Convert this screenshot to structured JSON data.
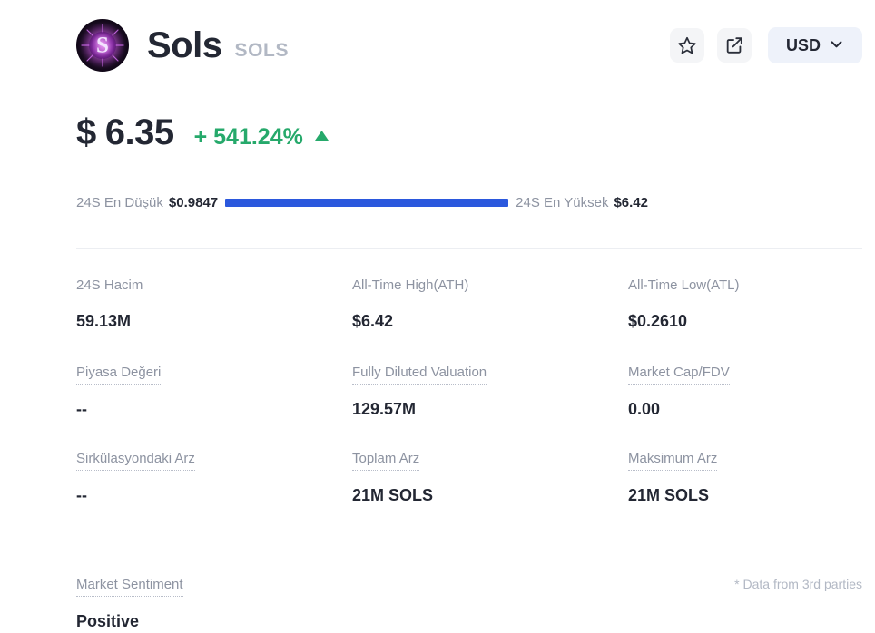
{
  "header": {
    "coin_name": "Sols",
    "coin_ticker": "SOLS",
    "logo_symbol": "S",
    "favorite_icon": "star-icon",
    "share_icon": "external-link-icon",
    "currency_label": "USD",
    "chevron_icon": "chevron-down-icon"
  },
  "price": {
    "currency_sign": "$",
    "value": "6.35",
    "change": "+ 541.24%",
    "change_direction": "up",
    "change_color": "#26a96b"
  },
  "range": {
    "low_label": "24S En Düşük",
    "low_value": "$0.9847",
    "high_label": "24S En Yüksek",
    "high_value": "$6.42",
    "fill_percent": 100,
    "fill_color": "#2b58dd"
  },
  "stats": {
    "row1": [
      {
        "label": "24S Hacim",
        "value": "59.13M",
        "dotted": false
      },
      {
        "label": "All-Time High(ATH)",
        "value": "$6.42",
        "dotted": false
      },
      {
        "label": "All-Time Low(ATL)",
        "value": "$0.2610",
        "dotted": false
      }
    ],
    "row2": [
      {
        "label": "Piyasa Değeri",
        "value": "--",
        "dotted": true
      },
      {
        "label": "Fully Diluted Valuation",
        "value": "129.57M",
        "dotted": true
      },
      {
        "label": "Market Cap/FDV",
        "value": "0.00",
        "dotted": true
      }
    ],
    "row3": [
      {
        "label": "Sirkülasyondaki Arz",
        "value": "--",
        "dotted": true
      },
      {
        "label": "Toplam Arz",
        "value": "21M SOLS",
        "dotted": true
      },
      {
        "label": "Maksimum Arz",
        "value": "21M SOLS",
        "dotted": true
      }
    ]
  },
  "footer": {
    "sentiment_label": "Market Sentiment",
    "sentiment_value": "Positive",
    "data_note": "* Data from 3rd parties"
  }
}
